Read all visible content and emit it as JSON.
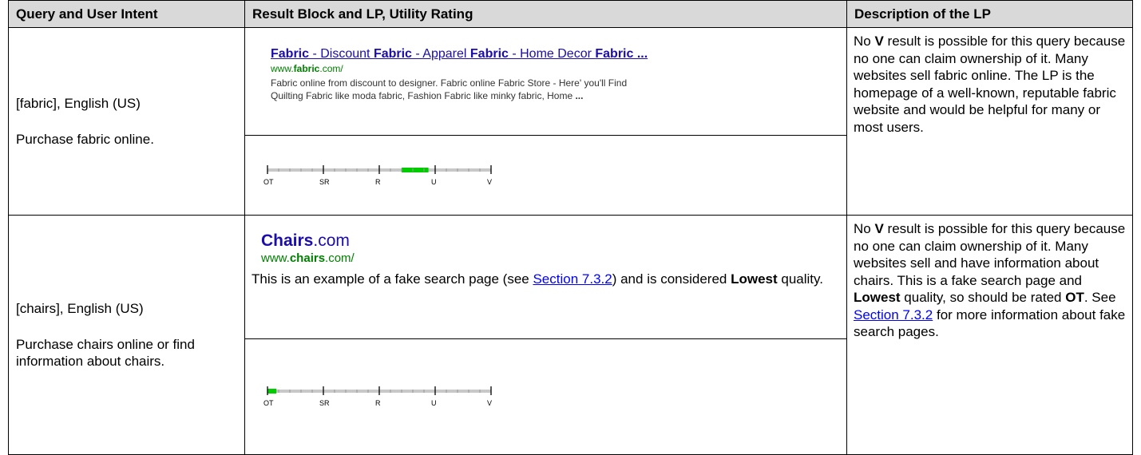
{
  "headers": {
    "query": "Query and User Intent",
    "result": "Result Block and LP, Utility Rating",
    "description": "Description of the LP"
  },
  "rows": [
    {
      "query": "[fabric], English (US)",
      "intent": "Purchase fabric online.",
      "result": {
        "title_parts": [
          {
            "text": "Fabric",
            "bold": true
          },
          {
            "text": " - Discount ",
            "bold": false
          },
          {
            "text": "Fabric",
            "bold": true
          },
          {
            "text": " - Apparel ",
            "bold": false
          },
          {
            "text": "Fabric",
            "bold": true
          },
          {
            "text": " - Home Decor ",
            "bold": false
          },
          {
            "text": "Fabric ...",
            "bold": true
          }
        ],
        "url_pre": "www.",
        "url_bold": "fabric",
        "url_post": ".com/",
        "snippet_line1": "Fabric online from discount to designer. Fabric online Fabric Store - Here' you'll Find",
        "snippet_line2": "Quilting Fabric like moda fabric, Fashion Fabric like minky fabric, Home ..."
      },
      "rating": {
        "scale": [
          "OT",
          "SR",
          "R",
          "U",
          "V"
        ],
        "value": "U",
        "fill_start": 0.6,
        "fill_end": 0.72
      },
      "description": "No V result is possible for this query because no one can claim ownership of it.  Many websites sell fabric online.  The LP is the homepage of a well-known, reputable fabric website and would be helpful for many or most users."
    },
    {
      "query": "[chairs], English (US)",
      "intent": "Purchase chairs online or find information about chairs.",
      "result": {
        "title_bold": "Chairs",
        "title_rest": ".com",
        "url_pre": "www.",
        "url_bold": "chairs",
        "url_post": ".com/",
        "note_pre": "This is an example of a fake search page (see ",
        "note_link": "Section 7.3.2",
        "note_mid": ") and is considered ",
        "note_bold": "Lowest",
        "note_post": " quality."
      },
      "rating": {
        "scale": [
          "OT",
          "SR",
          "R",
          "U",
          "V"
        ],
        "value": "OT",
        "fill_start": 0.0,
        "fill_end": 0.04
      },
      "description_parts": [
        {
          "text": "No ",
          "bold": false
        },
        {
          "text": "V",
          "bold": true
        },
        {
          "text": " result is possible for this query because no one can claim ownership of it.  Many websites sell and have information about chairs.  This is a fake search page and ",
          "bold": false
        },
        {
          "text": "Lowest",
          "bold": true
        },
        {
          "text": " quality, so should be rated ",
          "bold": false
        },
        {
          "text": "OT",
          "bold": true
        },
        {
          "text": ".  See ",
          "bold": false
        },
        {
          "text": "Section 7.3.2",
          "link": true
        },
        {
          "text": " for more information about fake search pages.",
          "bold": false
        }
      ]
    }
  ],
  "colors": {
    "header_bg": "#d9d9d9",
    "link": "#0000ff",
    "serp_title": "#1a0dab",
    "serp_url": "#008000",
    "rating_fill": "#00cc00",
    "rating_track": "#c8c8c8"
  }
}
